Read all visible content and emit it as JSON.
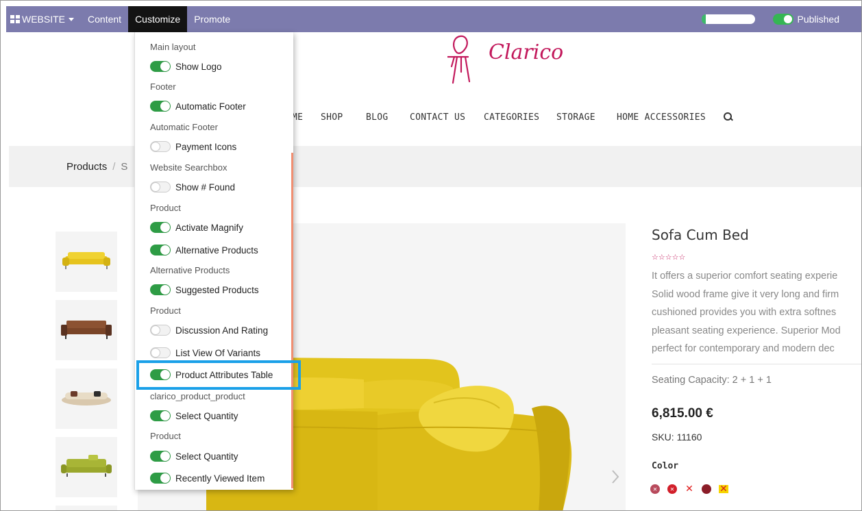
{
  "topbar": {
    "website_label": "WEBSITE",
    "items": [
      "Content",
      "Customize",
      "Promote"
    ],
    "published_label": "Published",
    "colors": {
      "bar": "#7c7bad",
      "active": "#131313",
      "toggle_on": "#35b653"
    }
  },
  "header": {
    "brand": "Clarico",
    "nav": [
      "ME",
      "SHOP",
      "BLOG",
      "CONTACT US",
      "CATEGORIES",
      "STORAGE",
      "HOME ACCESSORIES"
    ],
    "search_icon": "search-icon"
  },
  "breadcrumb": {
    "root": "Products",
    "current": "S"
  },
  "customize_menu": {
    "entries": [
      {
        "type": "header",
        "label": "Main layout"
      },
      {
        "type": "toggle",
        "label": "Show Logo",
        "on": true
      },
      {
        "type": "header",
        "label": "Footer"
      },
      {
        "type": "toggle",
        "label": "Automatic Footer",
        "on": true
      },
      {
        "type": "header",
        "label": "Automatic Footer"
      },
      {
        "type": "toggle",
        "label": "Payment Icons",
        "on": false
      },
      {
        "type": "header",
        "label": "Website Searchbox"
      },
      {
        "type": "toggle",
        "label": "Show # Found",
        "on": false
      },
      {
        "type": "header",
        "label": "Product"
      },
      {
        "type": "toggle",
        "label": "Activate Magnify",
        "on": true
      },
      {
        "type": "toggle",
        "label": "Alternative Products",
        "on": true
      },
      {
        "type": "header",
        "label": "Alternative Products"
      },
      {
        "type": "toggle",
        "label": "Suggested Products",
        "on": true
      },
      {
        "type": "header",
        "label": "Product"
      },
      {
        "type": "toggle",
        "label": "Discussion And Rating",
        "on": false
      },
      {
        "type": "toggle",
        "label": "List View Of Variants",
        "on": false
      },
      {
        "type": "toggle",
        "label": "Product Attributes Table",
        "on": true,
        "highlighted": true
      },
      {
        "type": "header",
        "label": "clarico_product_product"
      },
      {
        "type": "toggle",
        "label": "Select Quantity",
        "on": true
      },
      {
        "type": "header",
        "label": "Product"
      },
      {
        "type": "toggle",
        "label": "Select Quantity",
        "on": true
      },
      {
        "type": "toggle",
        "label": "Recently Viewed Item",
        "on": true
      }
    ],
    "highlight_color": "#1aa0e8"
  },
  "product": {
    "title": "Sofa Cum Bed",
    "rating_stars": "☆☆☆☆☆",
    "description_lines": [
      "It offers a superior comfort seating experie",
      "Solid wood frame give it very long and firm",
      "cushioned provides you with extra softnes",
      "pleasant seating experience. Superior Mod",
      "perfect for contemporary and modern dec"
    ],
    "seating": "Seating Capacity: 2 + 1 + 1",
    "price": "6,815.00 €",
    "sku": "SKU: 11160",
    "color_label": "Color",
    "swatches": [
      "#b84a5c",
      "#d21f2a",
      "#e01b1b",
      "#8b1d28",
      "#f7d500"
    ]
  }
}
